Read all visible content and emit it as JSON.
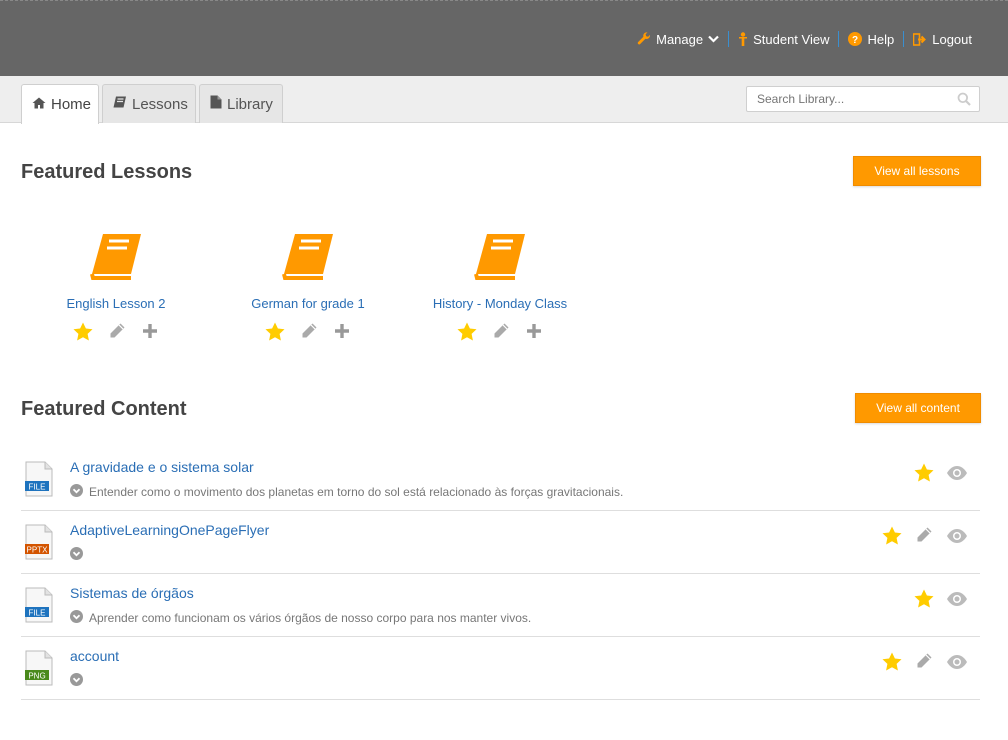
{
  "topnav": {
    "manage": "Manage",
    "student_view": "Student View",
    "help": "Help",
    "logout": "Logout"
  },
  "tabs": [
    {
      "label": "Home",
      "icon": "home-icon"
    },
    {
      "label": "Lessons",
      "icon": "book-icon"
    },
    {
      "label": "Library",
      "icon": "document-icon"
    }
  ],
  "search": {
    "placeholder": "Search Library..."
  },
  "featured_lessons": {
    "title": "Featured Lessons",
    "view_all_label": "View all lessons",
    "items": [
      {
        "title": "English Lesson 2"
      },
      {
        "title": "German for grade 1"
      },
      {
        "title": "History - Monday Class"
      }
    ]
  },
  "featured_content": {
    "title": "Featured Content",
    "view_all_label": "View all content",
    "items": [
      {
        "title": "A gravidade e o sistema solar",
        "type": "FILE",
        "description": "Entender como o movimento dos planetas em torno do sol está relacionado às forças gravitacionais.",
        "editable": false
      },
      {
        "title": "AdaptiveLearningOnePageFlyer",
        "type": "PPTX",
        "description": "",
        "editable": true
      },
      {
        "title": "Sistemas de órgãos",
        "type": "FILE",
        "description": "Aprender como funcionam os vários órgãos de nosso corpo para nos manter vivos.",
        "editable": false
      },
      {
        "title": "account",
        "type": "PNG",
        "description": "",
        "editable": true
      }
    ]
  },
  "colors": {
    "accent": "#ff9900",
    "link": "#2a6eb5",
    "star": "#ffcc00",
    "topbar": "#666666",
    "file_badge": "#1e73be",
    "pptx_badge": "#d35400",
    "png_badge": "#4a8a1c"
  }
}
